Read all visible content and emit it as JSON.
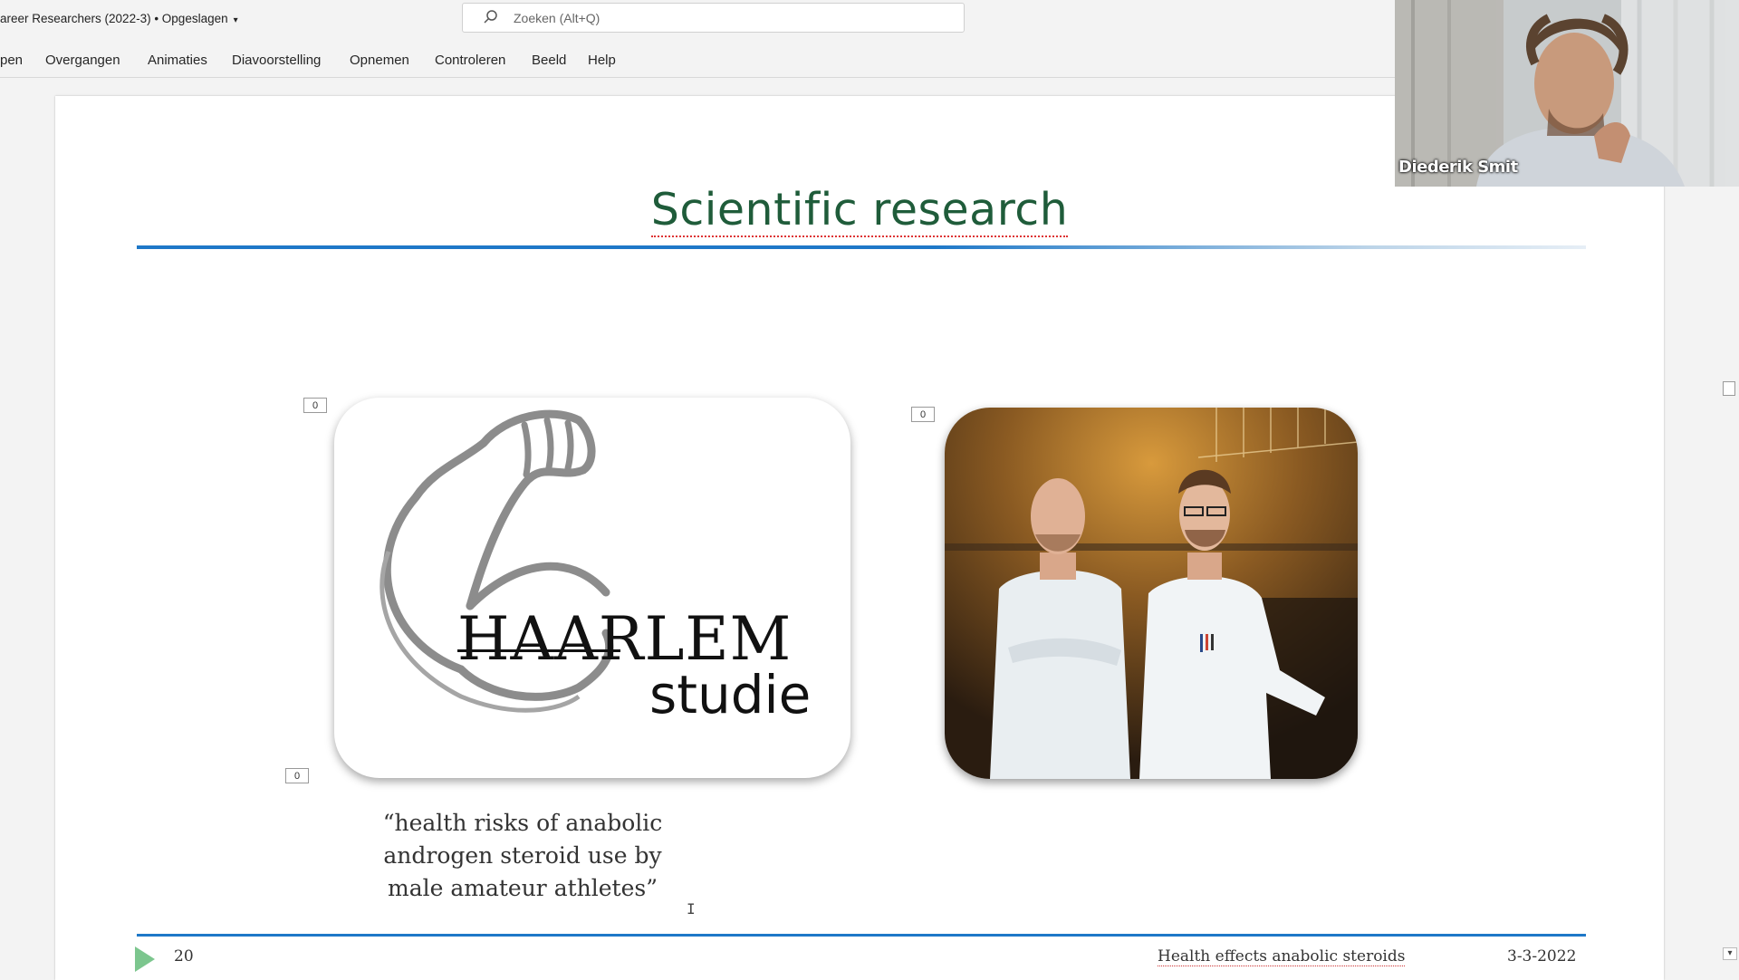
{
  "window": {
    "doc_title": "areer Researchers (2022-3) • Opgeslagen",
    "search_placeholder": "Zoeken (Alt+Q)"
  },
  "ribbon": {
    "tabs": [
      "pen",
      "Overgangen",
      "Animaties",
      "Diavoorstelling",
      "Opnemen",
      "Controleren",
      "Beeld",
      "Help"
    ]
  },
  "slide": {
    "title": "Scientific research",
    "placeholder_tags": [
      "0",
      "0",
      "0"
    ],
    "logo": {
      "word1": "HAARLEM",
      "word2": "studie"
    },
    "quote_lines": [
      "“health risks of anabolic",
      "androgen steroid use by",
      "male amateur athletes”"
    ],
    "footer": {
      "slide_number": "20",
      "text": "Health effects anabolic steroids",
      "date": "3-3-2022"
    }
  },
  "webcam": {
    "participant_name": "Diederik Smit"
  },
  "colors": {
    "title_green": "#1f5c3a",
    "accent_blue": "#1e78c8",
    "play_green": "#7cc68e"
  }
}
